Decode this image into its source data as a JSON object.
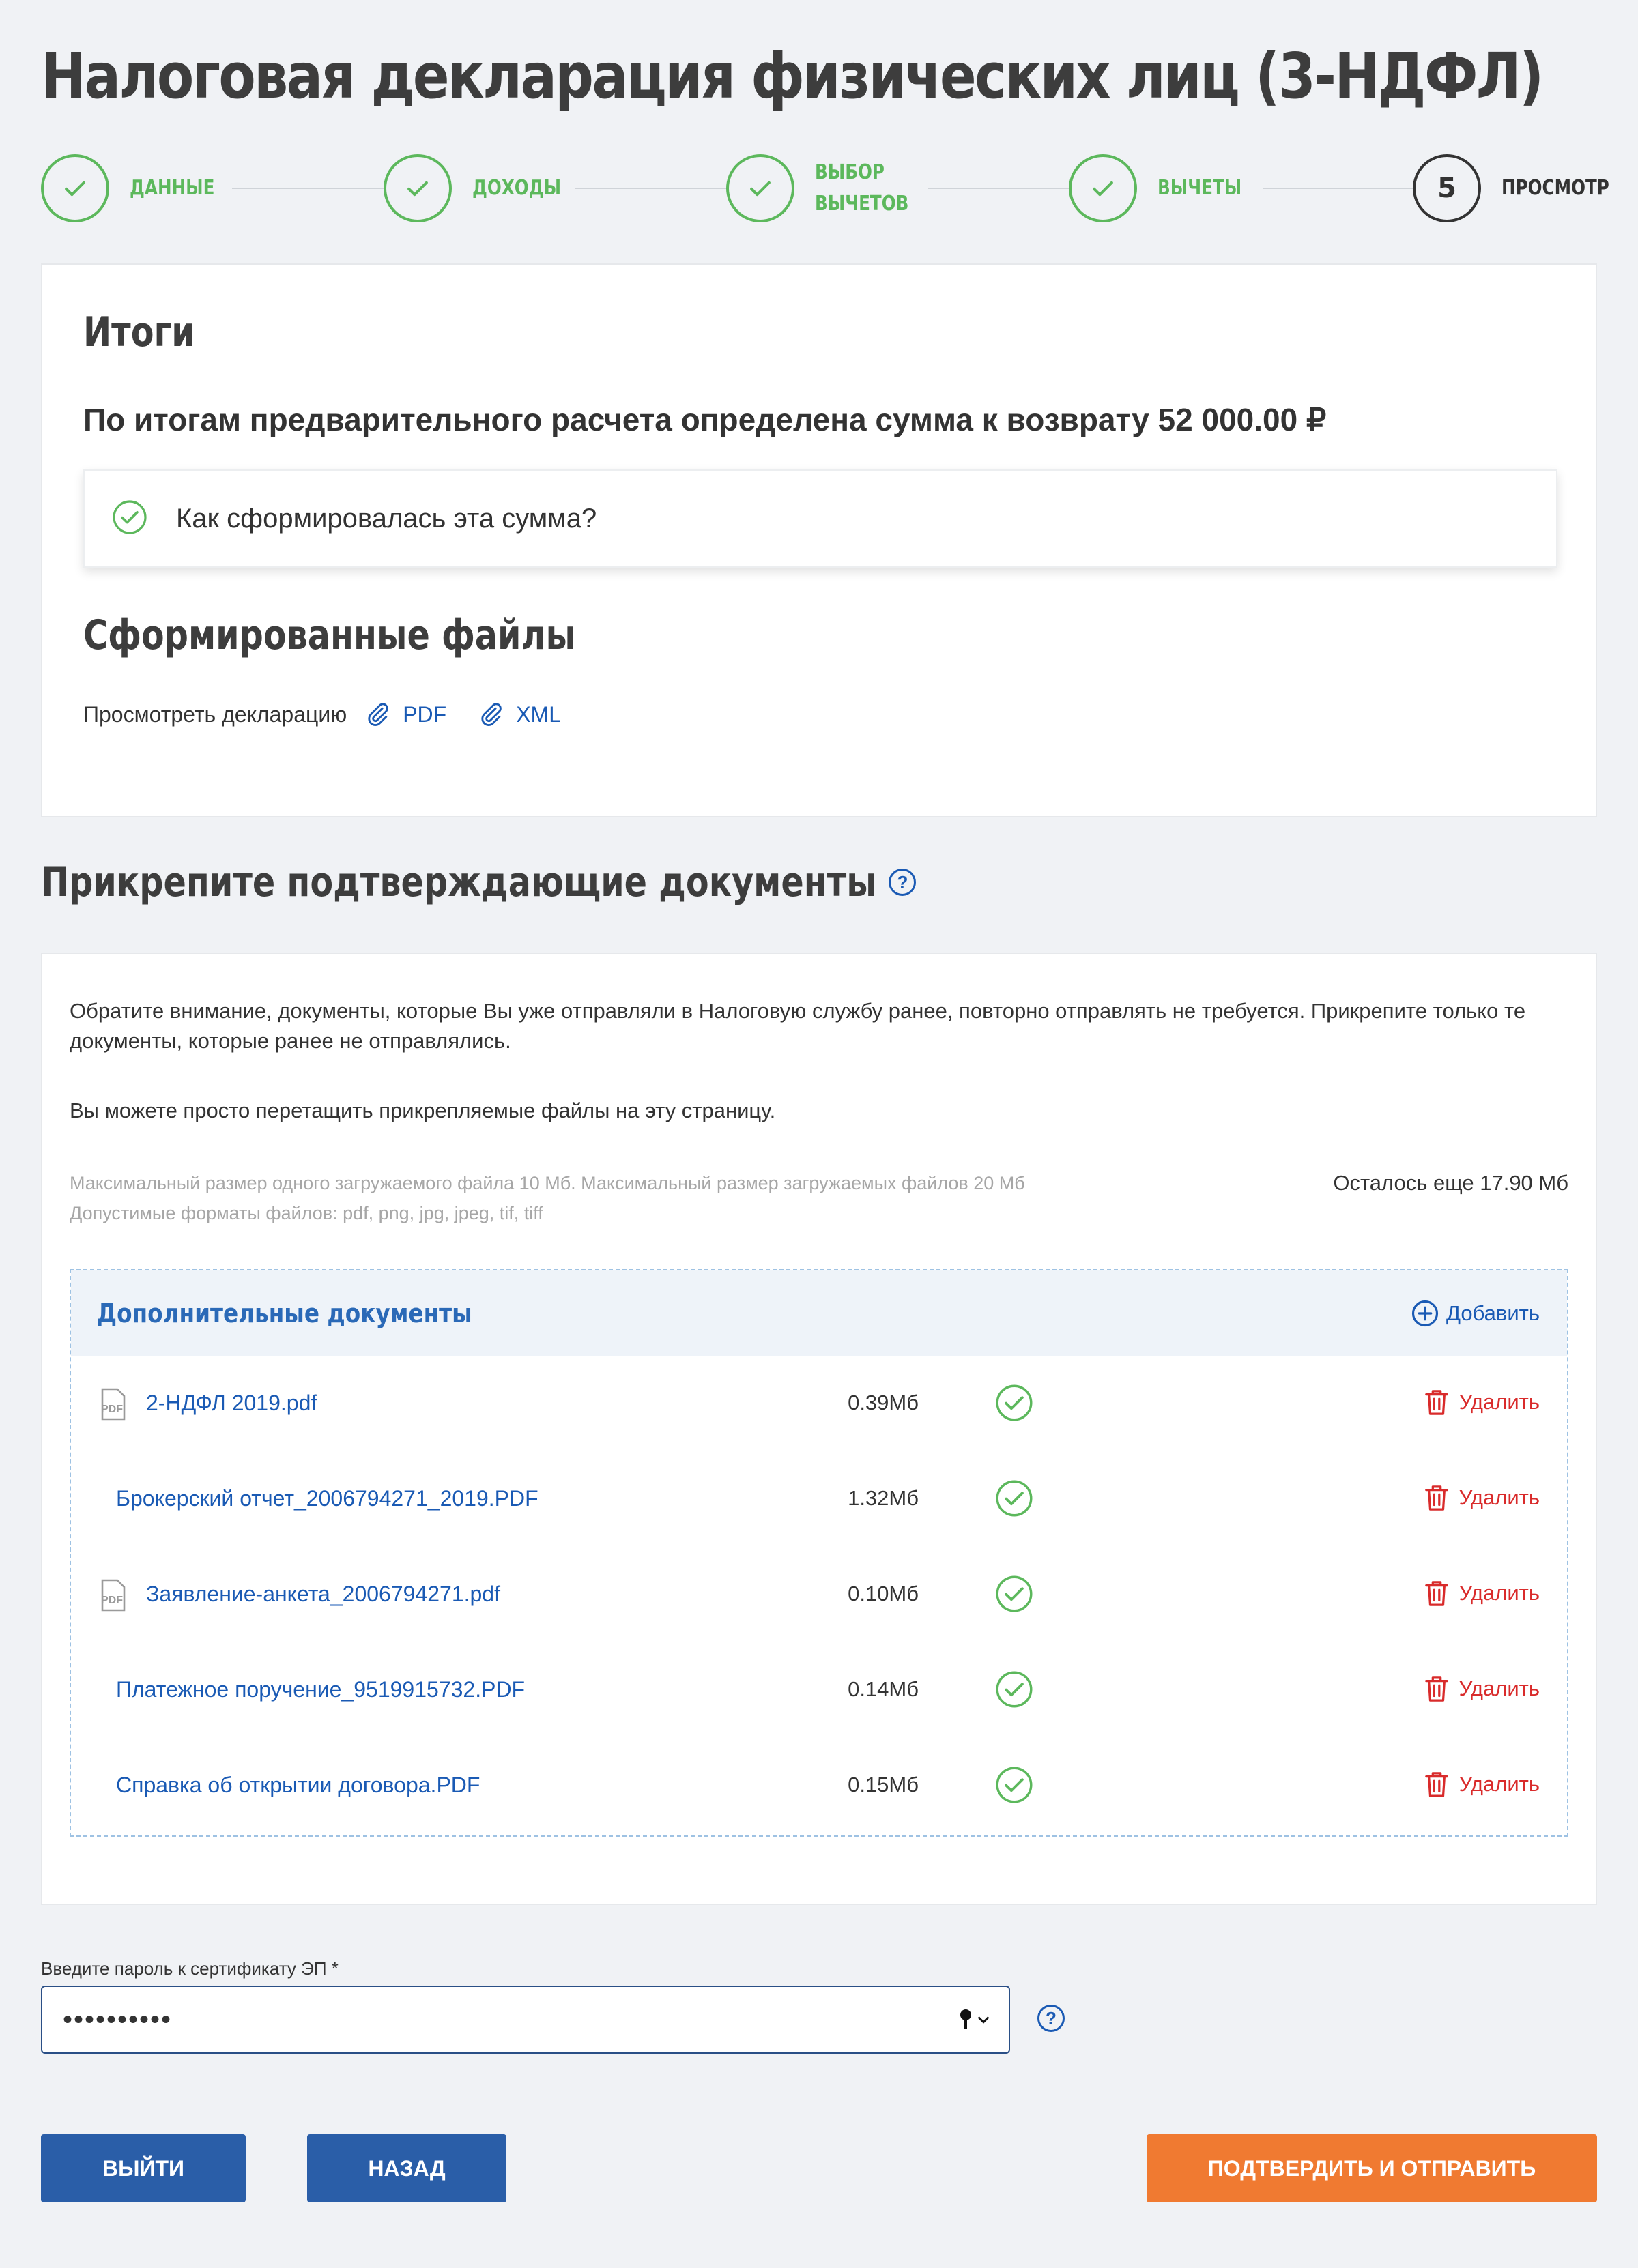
{
  "page": {
    "title": "Налоговая декларация физических лиц (3-НДФЛ)"
  },
  "stepper": {
    "steps": [
      {
        "label_line1": "Данные",
        "label_line2": "",
        "state": "done"
      },
      {
        "label_line1": "Доходы",
        "label_line2": "",
        "state": "done"
      },
      {
        "label_line1": "Выбор",
        "label_line2": "вычетов",
        "state": "done"
      },
      {
        "label_line1": "Вычеты",
        "label_line2": "",
        "state": "done"
      },
      {
        "label_line1": "Просмотр",
        "label_line2": "",
        "number": "5",
        "state": "current"
      }
    ]
  },
  "summary": {
    "heading": "Итоги",
    "text": "По итогам предварительного расчета определена сумма к возврату 52 000.00 ₽",
    "accordion_label": "Как сформировалась эта сумма?"
  },
  "files": {
    "heading": "Сформированные файлы",
    "view_label": "Просмотреть декларацию",
    "pdf_label": "PDF",
    "xml_label": "XML"
  },
  "attach": {
    "heading": "Прикрепите подтверждающие документы",
    "help": "?",
    "note1": "Обратите внимание, документы, которые Вы уже отправляли в Налоговую службу ранее, повторно отправлять не требуется. Прикрепите только те документы, которые ранее не отправлялись.",
    "note2": "Вы можете просто перетащить прикрепляемые файлы на эту страницу.",
    "limit_size": "Максимальный размер одного загружаемого файла 10 Мб. Максимальный размер загружаемых файлов 20 Мб",
    "limit_formats": "Допустимые форматы файлов: pdf, png, jpg, jpeg, tif, tiff",
    "remaining": "Осталось еще 17.90 Мб",
    "box_title": "Дополнительные документы",
    "add_label": "Добавить",
    "delete_label": "Удалить",
    "documents": [
      {
        "name": "2-НДФЛ 2019.pdf",
        "size": "0.39Мб",
        "icon": "pdf-file-icon"
      },
      {
        "name": "Брокерский отчет_2006794271_2019.PDF",
        "size": "1.32Мб",
        "icon": ""
      },
      {
        "name": "Заявление-анкета_2006794271.pdf",
        "size": "0.10Мб",
        "icon": "pdf-file-icon"
      },
      {
        "name": "Платежное поручение_9519915732.PDF",
        "size": "0.14Мб",
        "icon": ""
      },
      {
        "name": "Справка об открытии договора.PDF",
        "size": "0.15Мб",
        "icon": ""
      }
    ]
  },
  "password": {
    "label": "Введите пароль к сертификату ЭП *",
    "value": "••••••••••"
  },
  "actions": {
    "exit": "Выйти",
    "back": "Назад",
    "submit": "Подтвердить и отправить"
  },
  "colors": {
    "success": "#5cb85c",
    "link": "#1a5ab4",
    "danger": "#d92b2b",
    "primary_button": "#2a5ea8",
    "accent_button": "#f07a31"
  }
}
